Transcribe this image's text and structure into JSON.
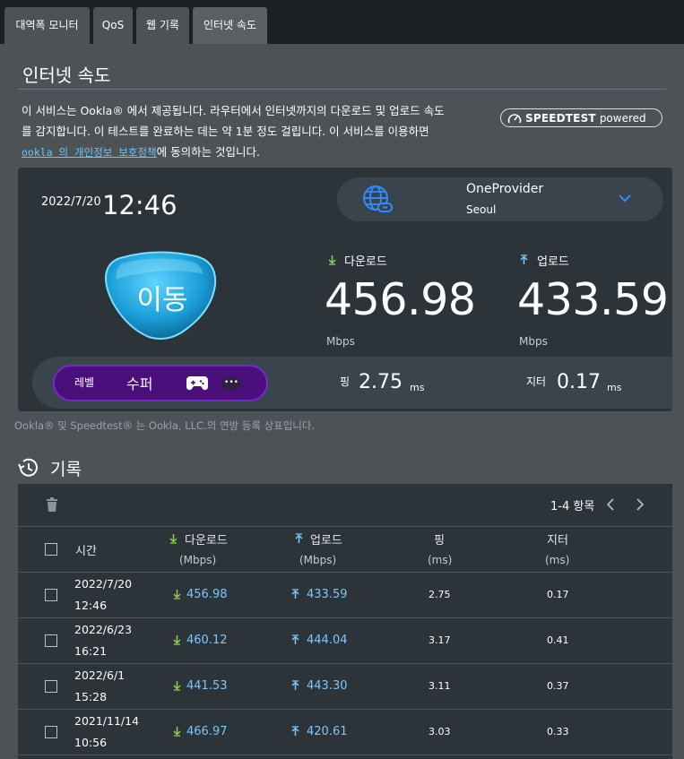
{
  "tabs": [
    {
      "label": "대역폭 모니터",
      "active": false
    },
    {
      "label": "QoS",
      "active": false
    },
    {
      "label": "웹 기록",
      "active": false
    },
    {
      "label": "인터넷 속도",
      "active": true
    }
  ],
  "page": {
    "title": "인터넷 속도",
    "desc_line1": "이 서비스는 Ookla® 에서 제공됩니다. 라우터에서 인터넷까지의 다운로드 및 업로드 속도",
    "desc_line2": "를 감지합니다. 이 테스트를 완료하는 데는 약 1분 정도 걸립니다. 이 서비스를 이용하면",
    "desc_link": "ookla 의 개인정보 보호정책",
    "desc_tail": "에 동의하는 것입니다.",
    "badge_bold": "SPEEDTEST",
    "badge_light": "powered",
    "trademark": "Ookla® 및 Speedtest® 는 Ookla, LLC.의 연방 등록 상표입니다."
  },
  "result": {
    "date": "2022/7/20",
    "time": "12:46",
    "server_name": "OneProvider",
    "server_city": "Seoul",
    "status_badge": "이동",
    "download_label": "다운로드",
    "download_value": "456.98",
    "download_unit": "Mbps",
    "upload_label": "업로드",
    "upload_value": "433.59",
    "upload_unit": "Mbps",
    "level_label": "레벨",
    "level_value": "수퍼",
    "more_label": "•••",
    "ping_label": "핑",
    "ping_value": "2.75",
    "ping_unit": "ms",
    "jitter_label": "지터",
    "jitter_value": "0.17",
    "jitter_unit": "ms"
  },
  "history": {
    "title": "기록",
    "pager": "1-4 항목",
    "columns": {
      "time": "시간",
      "download": "다운로드",
      "download_unit": "(Mbps)",
      "upload": "업로드",
      "upload_unit": "(Mbps)",
      "ping": "핑",
      "ping_unit": "(ms)",
      "jitter": "지터",
      "jitter_unit": "(ms)"
    },
    "rows": [
      {
        "date": "2022/7/20",
        "time": "12:46",
        "download": "456.98",
        "upload": "433.59",
        "ping": "2.75",
        "jitter": "0.17"
      },
      {
        "date": "2022/6/23",
        "time": "16:21",
        "download": "460.12",
        "upload": "444.04",
        "ping": "3.17",
        "jitter": "0.41"
      },
      {
        "date": "2022/6/1",
        "time": "15:28",
        "download": "441.53",
        "upload": "443.30",
        "ping": "3.11",
        "jitter": "0.37"
      },
      {
        "date": "2021/11/14",
        "time": "10:56",
        "download": "466.97",
        "upload": "420.61",
        "ping": "3.03",
        "jitter": "0.33"
      }
    ]
  },
  "colors": {
    "accent": "#6cc5ff",
    "download_arrow": "#8bd34a",
    "upload_arrow": "#7cc8ff",
    "level_pill": "#4a0f7a"
  }
}
